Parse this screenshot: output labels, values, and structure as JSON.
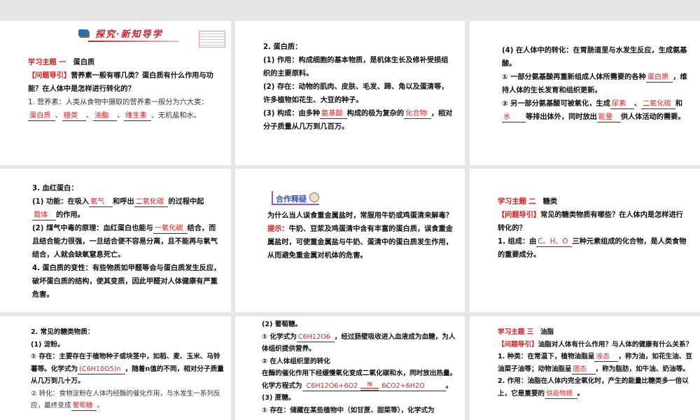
{
  "slides": [
    {
      "banner": "探究·新知导学",
      "paras": [
        [
          {
            "k": "h",
            "t": "学习主题 一"
          },
          {
            "k": "b",
            "t": "　蛋白质"
          }
        ],
        [
          {
            "k": "h",
            "t": "【问题导引】"
          },
          {
            "k": "b",
            "t": "营养素一般有哪几类？蛋白质有什么作用与功能？在人体中是怎样进行转化的？"
          }
        ],
        [
          {
            "k": "n",
            "t": "1. 营养素：人类从食物中摄取的营养素一般分为六大类："
          },
          {
            "k": "a",
            "t": "蛋白质"
          },
          {
            "k": "n",
            "t": "、"
          },
          {
            "k": "a",
            "t": "糖类"
          },
          {
            "k": "n",
            "t": "、"
          },
          {
            "k": "a",
            "t": "油脂"
          },
          {
            "k": "n",
            "t": "、"
          },
          {
            "k": "a",
            "t": "维生素"
          },
          {
            "k": "n",
            "t": "、无机盐和水。"
          }
        ]
      ]
    },
    {
      "paras": [
        [
          {
            "k": "b",
            "t": "2. 蛋白质："
          }
        ],
        [
          {
            "k": "b",
            "t": "(1) 作用：构成细胞的基本物质，是机体生长及修补受损组织的主要原料。"
          }
        ],
        [
          {
            "k": "b",
            "t": "(2) 存在：动物的肌肉、皮肤、毛发、蹄、角以及蛋清等，许多植物如花生、大豆的种子。"
          }
        ],
        [
          {
            "k": "b",
            "t": "(3) 构成：由多种"
          },
          {
            "k": "a",
            "t": "氨基酸"
          },
          {
            "k": "b",
            "t": "构成的极为复杂的"
          },
          {
            "k": "a",
            "t": "化合物"
          },
          {
            "k": "b",
            "t": "，相对分子质量从几万到几百万。"
          }
        ]
      ]
    },
    {
      "paras": [
        [
          {
            "k": "b",
            "t": "(4) 在人体中的转化：在胃肠道里与水发生反应，生成氨基酸。"
          }
        ],
        [
          {
            "k": "b",
            "t": "① 一部分氨基酸再重新组成人体所需要的各种"
          },
          {
            "k": "a",
            "t": "蛋白质"
          },
          {
            "k": "b",
            "t": "，维持人体的生长发育和组织更新。"
          }
        ],
        [
          {
            "k": "b",
            "t": "② 另一部分氨基酸可被氧化，生成"
          },
          {
            "k": "a",
            "t": "尿素"
          },
          {
            "k": "b",
            "t": "、"
          },
          {
            "k": "a",
            "t": "二氧化碳"
          },
          {
            "k": "b",
            "t": "和"
          },
          {
            "k": "a",
            "t": "水"
          },
          {
            "k": "b",
            "t": "等排出体外，同时放出"
          },
          {
            "k": "a",
            "t": "能量"
          },
          {
            "k": "b",
            "t": "供人体活动的需要。"
          }
        ]
      ]
    },
    {
      "paras": [
        [
          {
            "k": "b",
            "t": "3. 血红蛋白："
          }
        ],
        [
          {
            "k": "b",
            "t": "(1) 功能：在吸入"
          },
          {
            "k": "a",
            "t": "氧气"
          },
          {
            "k": "b",
            "t": "和呼出"
          },
          {
            "k": "a",
            "t": "二氧化碳"
          },
          {
            "k": "b",
            "t": "的过程中起"
          },
          {
            "k": "a",
            "t": "载体"
          },
          {
            "k": "b",
            "t": "的作用。"
          }
        ],
        [
          {
            "k": "b",
            "t": "(2) 煤气中毒的原理：血红蛋白也能与"
          },
          {
            "k": "a",
            "t": "一氧化碳"
          },
          {
            "k": "b",
            "t": "结合，而且结合能力很强，一旦结合便不容易分离，且不能再与氧气结合，人就会缺氧窒息死亡。"
          }
        ],
        [
          {
            "k": "b",
            "t": "4. 蛋白质的变性：有些物质如甲醛等会与蛋白质发生反应，破坏蛋白质的结构，使其变质，因此甲醛对人体健康有严重危害。"
          }
        ]
      ]
    },
    {
      "section": "合作释疑",
      "paras": [
        [
          {
            "k": "b",
            "t": "为什么当人误食重金属盐时，常服用牛奶或鸡蛋清来解毒？"
          }
        ],
        [
          {
            "k": "t",
            "t": "提示："
          },
          {
            "k": "b",
            "t": "牛奶、豆浆及鸡蛋清中含有丰富的蛋白质，误食重金属盐时，可使重金属盐与牛奶、蛋清中的蛋白质发生作用，从而避免重金属对机体的危害。"
          }
        ]
      ]
    },
    {
      "paras": [
        [
          {
            "k": "h",
            "t": "学习主题 二"
          },
          {
            "k": "b",
            "t": "　糖类"
          }
        ],
        [
          {
            "k": "h",
            "t": "【问题导引】"
          },
          {
            "k": "b",
            "t": "常见的糖类物质有哪些？在人体内是怎样进行转化的？"
          }
        ],
        [
          {
            "k": "b",
            "t": "1. 组成：由"
          },
          {
            "k": "a",
            "t": "C、H、O"
          },
          {
            "k": "b",
            "t": "三种元素组成的化合物，是人类食物的重要成分。"
          }
        ]
      ]
    },
    {
      "paras": [
        [
          {
            "k": "b",
            "t": "2. 常见的糖类物质："
          }
        ],
        [
          {
            "k": "b",
            "t": "(1) 淀粉。"
          }
        ],
        [
          {
            "k": "b",
            "t": "① 存在：主要存在于植物种子或块茎中，如稻、麦、玉米、马铃薯等。化学式为"
          },
          {
            "k": "a",
            "t": "(C6H10O5)n",
            "f": true
          },
          {
            "k": "b",
            "t": "，随着n值的不同，相对分子质量从几万到几十万。"
          }
        ],
        [
          {
            "k": "n",
            "t": "② 转化：食物淀粉在人体内经酶的催化作用，与水发生一系列反应，最终变成"
          },
          {
            "k": "a",
            "t": "葡萄糖"
          },
          {
            "k": "n",
            "t": "。"
          }
        ]
      ]
    },
    {
      "paras": [
        [
          {
            "k": "b",
            "t": "(2) 葡萄糖。"
          }
        ],
        [
          {
            "k": "b",
            "t": "① 化学式为"
          },
          {
            "k": "a",
            "t": "C6H12O6",
            "f": true
          },
          {
            "k": "b",
            "t": "，经过肠壁吸收进入血液成为血糖，为人体组织提供营养。"
          }
        ],
        [
          {
            "k": "b",
            "t": "② 在人体组织里的转化"
          }
        ],
        [
          {
            "k": "b",
            "t": "在酶的催化作用下经缓慢氧化变成二氧化碳和水，同时放出热量。化学方程式为"
          },
          {
            "k": "eq",
            "l": "C6H12O6+6O2",
            "c": "酶",
            "r": "6CO2+6H2O"
          },
          {
            "k": "b",
            "t": "。"
          }
        ],
        [
          {
            "k": "b",
            "t": "(3) 蔗糖。"
          }
        ],
        [
          {
            "k": "b",
            "t": "① 存在：储藏在某些植物中（如甘蔗、甜菜等），化学式为"
          }
        ]
      ]
    },
    {
      "paras": [
        [
          {
            "k": "h",
            "t": "学习主题 三"
          },
          {
            "k": "b",
            "t": "　油脂"
          }
        ],
        [
          {
            "k": "h",
            "t": "【问题导引】"
          },
          {
            "k": "b",
            "t": "油脂对人体有什么作用？与人体的健康有什么关系？"
          }
        ],
        [
          {
            "k": "b",
            "t": "1. 种类：在常温下，植物油脂呈"
          },
          {
            "k": "a",
            "t": "液态"
          },
          {
            "k": "b",
            "t": "，称为油，如花生油、豆油菜子油等；动物油脂呈"
          },
          {
            "k": "a",
            "t": "固态"
          },
          {
            "k": "b",
            "t": "，称为脂肪，如牛油、奶油等。"
          }
        ],
        [
          {
            "k": "b",
            "t": "2. 作用：油脂在人体内完全氧化时，产生的能量比糖类多一倍以上，它是重要的"
          },
          {
            "k": "a",
            "t": "供能物质"
          },
          {
            "k": "b",
            "t": "。"
          }
        ]
      ]
    }
  ]
}
